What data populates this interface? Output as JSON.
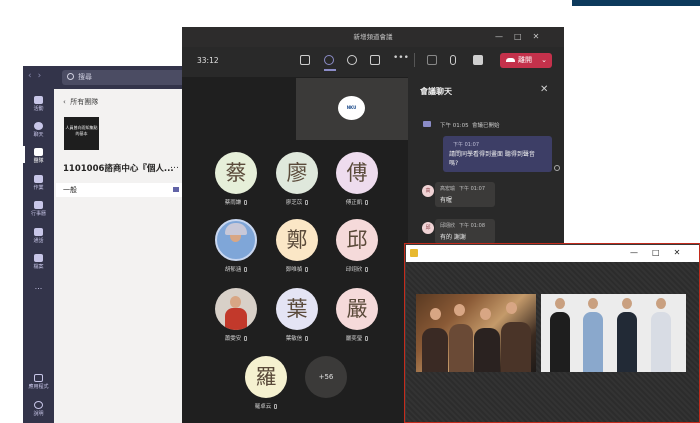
{
  "teams": {
    "nav_back": "‹",
    "nav_forward": "›",
    "search_placeholder": "搜尋",
    "rail": [
      {
        "label": "活動",
        "icon": "bell-icon"
      },
      {
        "label": "聊天",
        "icon": "chat-icon"
      },
      {
        "label": "團隊",
        "icon": "teams-icon",
        "active": true
      },
      {
        "label": "作業",
        "icon": "assignments-icon"
      },
      {
        "label": "行事曆",
        "icon": "calendar-icon"
      },
      {
        "label": "通話",
        "icon": "phone-icon"
      },
      {
        "label": "檔案",
        "icon": "files-icon"
      },
      {
        "label": "...",
        "icon": "more-icon"
      },
      {
        "label": "應用程式",
        "icon": "apps-icon"
      },
      {
        "label": "說明",
        "icon": "help-icon"
      }
    ],
    "all_teams": "所有團隊",
    "team_thumb_text": "人員曾向而知集點的基本",
    "team_name": "1101006諮商中心『個人...",
    "team_more": "…",
    "channel_name": "一般"
  },
  "meeting": {
    "window_title": "新增頻道會議",
    "window_controls": [
      "—",
      "□",
      "✕"
    ],
    "timer": "33:12",
    "leave_label": "離開",
    "leave_dropdown": "⌄",
    "share_logo_text": "NKU",
    "participants": [
      {
        "char": "蔡",
        "name": "蔡雨謙",
        "bg": "#e6efd9"
      },
      {
        "char": "廖",
        "name": "廖芝苡",
        "bg": "#dfe8dc"
      },
      {
        "char": "傅",
        "name": "傅正凱",
        "bg": "#eedcee"
      },
      {
        "char": "",
        "name": "胡郁涵",
        "bg": "#7fa6d8",
        "photo": true
      },
      {
        "char": "鄭",
        "name": "鄭唯禎",
        "bg": "#fbe7c6"
      },
      {
        "char": "邱",
        "name": "邱翊欣",
        "bg": "#f5dada"
      },
      {
        "char": "",
        "name": "蕭雯安",
        "bg": "#d8d0c8",
        "photo": true
      },
      {
        "char": "葉",
        "name": "葉敏信",
        "bg": "#e4e4f4"
      },
      {
        "char": "嚴",
        "name": "嚴奕瑩",
        "bg": "#f5dada"
      },
      {
        "char": "羅",
        "name": "羅卓云",
        "bg": "#f5f1d0"
      }
    ],
    "more_count": "+56"
  },
  "chat": {
    "title": "會議聊天",
    "close": "✕",
    "system_time": "下午 01:05",
    "system_text": "會議已開始",
    "my_message": {
      "time": "下午 01:07",
      "line1": "請問同學看得到畫面 聽得到聲音",
      "line2": "嗎?"
    },
    "messages": [
      {
        "avatar": "高",
        "sender": "高宏瑜",
        "time": "下午 01:07",
        "text": "有喔"
      },
      {
        "avatar": "邱",
        "sender": "邱翊欣",
        "time": "下午 01:08",
        "text": "有的 謝謝"
      }
    ]
  },
  "popup": {
    "window_controls": [
      "—",
      "□",
      "✕"
    ]
  }
}
